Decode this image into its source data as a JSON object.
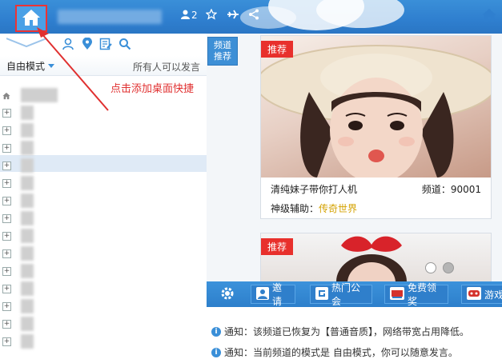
{
  "topbar": {
    "member_count": "2",
    "icons": [
      "home-icon",
      "user-icon",
      "star-icon",
      "airplane-icon",
      "share-icon",
      "home-icon"
    ]
  },
  "left_panel": {
    "toolbar_icons": [
      "user-pin-icon",
      "location-icon",
      "edit-note-icon",
      "search-icon"
    ],
    "mode_label": "自由模式",
    "everyone_label": "所有人可以发言",
    "tree_expand_symbol": "+"
  },
  "annotation": {
    "text": "点击添加桌面快捷"
  },
  "channel_tab": {
    "line1": "频道",
    "line2": "推荐"
  },
  "cards": [
    {
      "tag": "推荐",
      "title": "清纯妹子带你打人机",
      "channel_label": "频道：90001",
      "sub_label": "神级辅助：",
      "sub_value": "传奇世界"
    },
    {
      "tag": "推荐"
    }
  ],
  "bottom_toolbar": {
    "invite": "邀请",
    "hot_guild": "热门公会",
    "free_gift": "免费领奖",
    "games": "游戏"
  },
  "messages": [
    "通知：该频道已恢复为【普通音质】，网络带宽占用降低。",
    "通知：当前频道的模式是 自由模式，你可以随意发言。"
  ],
  "colors": {
    "accent_blue": "#3a8fd8",
    "tag_red": "#e8302c",
    "annotation_red": "#e03030",
    "gold": "#d4a200"
  }
}
